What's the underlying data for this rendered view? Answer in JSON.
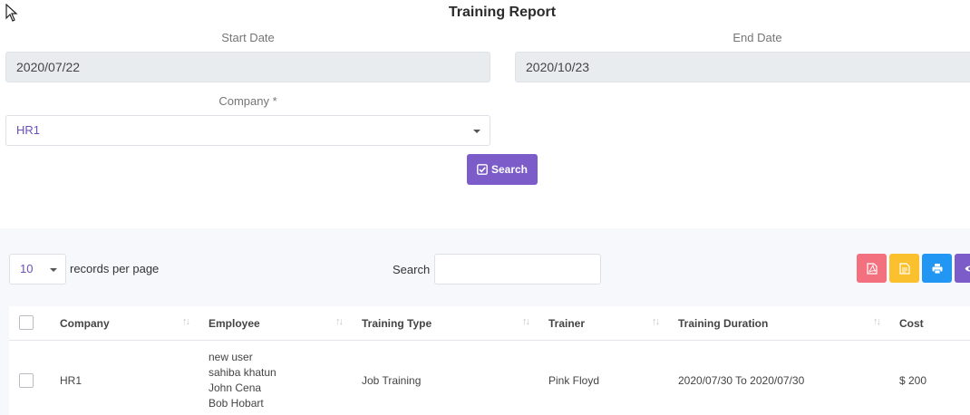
{
  "page_title": "Training Report",
  "filters": {
    "start_date_label": "Start Date",
    "start_date_value": "2020/07/22",
    "end_date_label": "End Date",
    "end_date_value": "2020/10/23",
    "company_label": "Company *",
    "company_value": "HR1",
    "search_button": "Search"
  },
  "table_controls": {
    "page_length": "10",
    "records_per_page": "records per page",
    "search_label": "Search",
    "search_value": ""
  },
  "toolbar": {
    "buttons": [
      {
        "name": "pdf-icon",
        "color": "#f3707f"
      },
      {
        "name": "document-icon",
        "color": "#fbc02d"
      },
      {
        "name": "print-icon",
        "color": "#2196f3"
      },
      {
        "name": "eye-icon",
        "color": "#7b5cc9"
      }
    ]
  },
  "table": {
    "columns": [
      "Company",
      "Employee",
      "Training Type",
      "Trainer",
      "Training Duration",
      "Cost"
    ],
    "rows": [
      {
        "company": "HR1",
        "employees": [
          "new user",
          "sahiba khatun",
          "John Cena",
          "Bob Hobart"
        ],
        "training_type": "Job Training",
        "trainer": "Pink Floyd",
        "duration": "2020/07/30 To 2020/07/30",
        "cost": "$ 200"
      }
    ]
  },
  "colors": {
    "accent": "#7b5cc9",
    "input_disabled_bg": "#e9ecef",
    "lower_bg": "#f7f8fb"
  }
}
